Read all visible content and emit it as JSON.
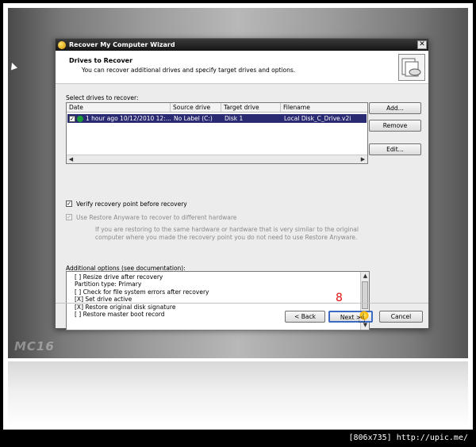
{
  "window": {
    "title": "Recover My Computer Wizard",
    "close_glyph": "✕"
  },
  "header": {
    "title": "Drives to Recover",
    "subtitle": "You can recover additional drives and specify target drives and options."
  },
  "drives": {
    "label": "Select drives to recover:",
    "columns": [
      "Date",
      "Source drive",
      "Target drive",
      "Filename"
    ],
    "rows": [
      {
        "checked": true,
        "status_icon": "green-status-icon",
        "date": "1 hour ago 10/12/2010 12:...",
        "source": "No Label (C:)",
        "target": "Disk 1",
        "filename": "Local Disk_C_Drive.v2i"
      }
    ]
  },
  "buttons": {
    "add": "Add...",
    "remove": "Remove",
    "edit": "Edit...",
    "back": "< Back",
    "next": "Next >",
    "cancel": "Cancel"
  },
  "options": {
    "verify_label": "Verify recovery point before recovery",
    "verify_checked": true,
    "restore_anyware_label": "Use Restore Anyware to recover to different hardware",
    "restore_anyware_checked": true,
    "restore_anyware_note": "If you are restoring to the same hardware or hardware that is very similar to the original computer where you made the recovery point you do not need to use Restore Anyware.",
    "additional_label": "Additional options (see documentation):",
    "additional_items": [
      "[ ] Resize drive after recovery",
      "Partition type:  Primary",
      "[ ] Check for file system errors after recovery",
      "[X] Set drive active",
      "[X] Restore original disk signature",
      "[ ] Restore master boot record"
    ]
  },
  "annotation": {
    "step": "8"
  },
  "footer": {
    "watermark": "[806x735] http://upic.me/",
    "brand": "MC16"
  },
  "colors": {
    "selection": "#2a2a72",
    "title_bar": "#151515",
    "annotation": "#e01010"
  }
}
